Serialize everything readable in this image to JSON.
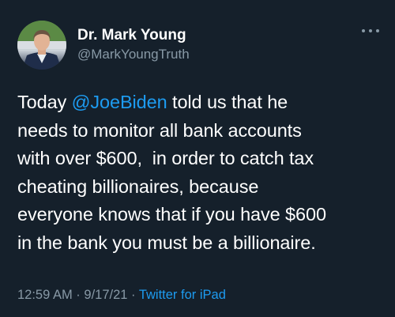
{
  "author": {
    "display_name": "Dr. Mark Young",
    "handle": "@MarkYoungTruth"
  },
  "tweet": {
    "lines": [
      {
        "before": "Today ",
        "mention": "@JoeBiden",
        "after": " told us that he"
      },
      {
        "text": "needs to monitor all bank accounts"
      },
      {
        "text": "with over $600,  in order to catch tax"
      },
      {
        "text": "cheating billionaires, because"
      },
      {
        "text": "everyone knows that if you have $600"
      },
      {
        "text": "in the bank you must be a billionaire."
      }
    ]
  },
  "meta": {
    "time": "12:59 AM",
    "separator": " · ",
    "date": "9/17/21",
    "source": "Twitter for iPad"
  },
  "icons": {
    "more": "more-options-icon",
    "avatar": "profile-photo"
  },
  "colors": {
    "background": "#15202b",
    "text": "#ffffff",
    "secondary": "#8899a6",
    "accent": "#1d9bf0"
  }
}
